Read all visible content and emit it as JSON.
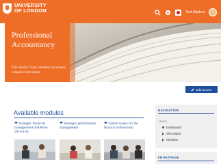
{
  "header": {
    "logo_line1": "UNIVERSITY",
    "logo_line2": "OF LONDON",
    "user_name": "Test Student"
  },
  "hero": {
    "title_line1": "Professional",
    "title_line2": "Accountancy",
    "subtitle": "The World Class: studied anywhere, valued everywhere"
  },
  "actions": {
    "edit_label": "Edit access"
  },
  "modules": {
    "heading": "Available modules",
    "items": [
      {
        "title": "Strategic financial management (FAMom-2016-1A)"
      },
      {
        "title": "Strategic performance management"
      },
      {
        "title": "Global issues for the finance professional"
      }
    ]
  },
  "navigation": {
    "heading": "NAVIGATION",
    "home": "Home",
    "items": [
      "Dashboard",
      "Site pages",
      "Modules"
    ]
  },
  "second_block": {
    "heading": "FRONTPAGE"
  },
  "colors": {
    "brand_orange": "#ee6d27",
    "brand_blue": "#1f4e9c"
  },
  "icons": [
    "search-icon",
    "chat-icon",
    "flag-icon",
    "avatar"
  ]
}
